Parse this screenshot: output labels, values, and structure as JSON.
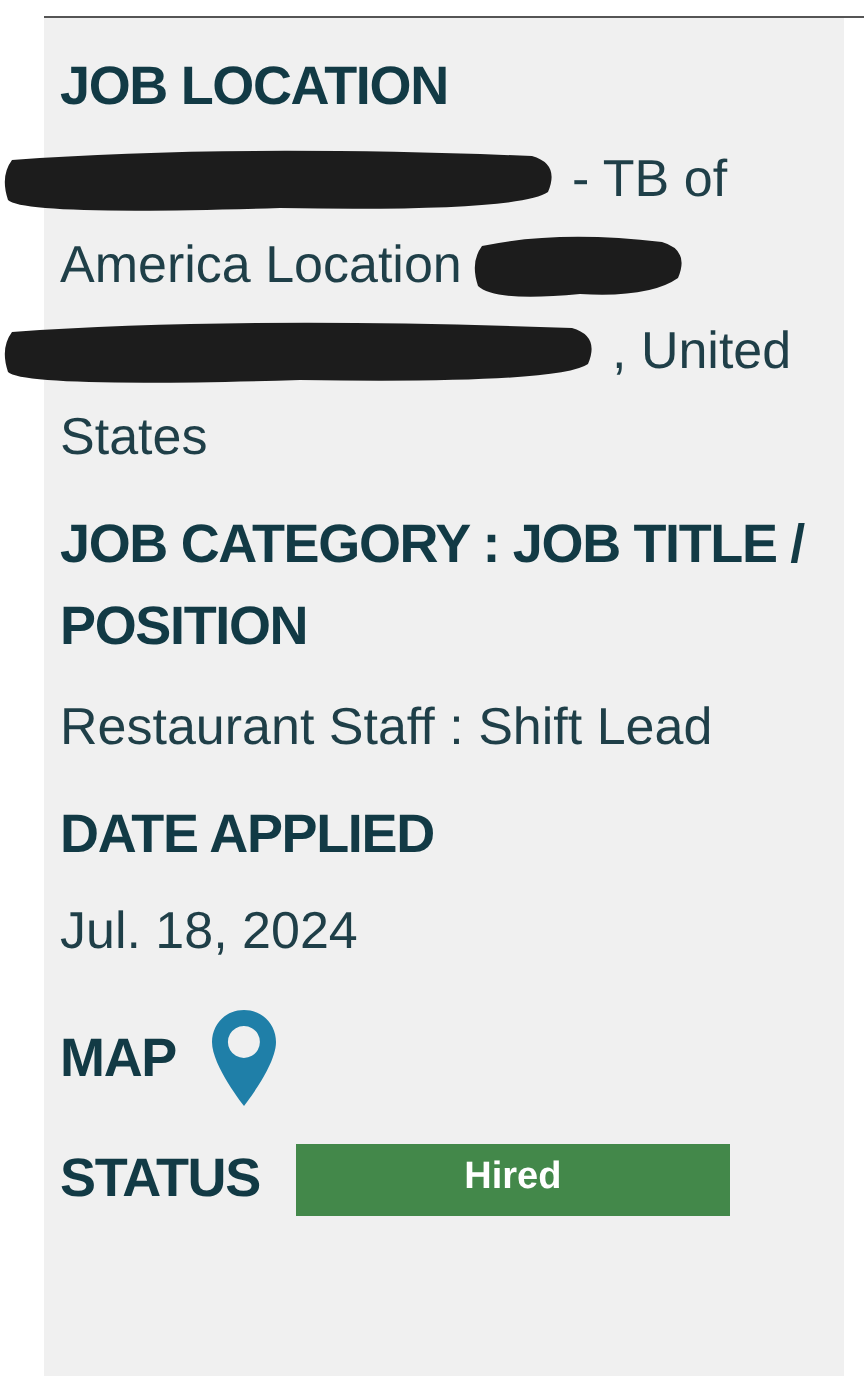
{
  "location": {
    "heading": "JOB LOCATION",
    "lines": [
      [
        {
          "kind": "redaction"
        },
        {
          "kind": "text",
          "text": "- TB of"
        }
      ],
      [
        {
          "kind": "text",
          "text": "America Location"
        },
        {
          "kind": "redaction"
        }
      ],
      [
        {
          "kind": "redaction"
        },
        {
          "kind": "text",
          "text": ", United"
        }
      ],
      [
        {
          "kind": "text",
          "text": "States"
        }
      ]
    ]
  },
  "category": {
    "heading": "JOB CATEGORY : JOB TITLE / POSITION",
    "value": "Restaurant Staff : Shift Lead"
  },
  "date_applied": {
    "heading": "DATE APPLIED",
    "value": "Jul. 18, 2024"
  },
  "map": {
    "label": "MAP"
  },
  "status": {
    "label": "STATUS",
    "value": "Hired"
  }
}
